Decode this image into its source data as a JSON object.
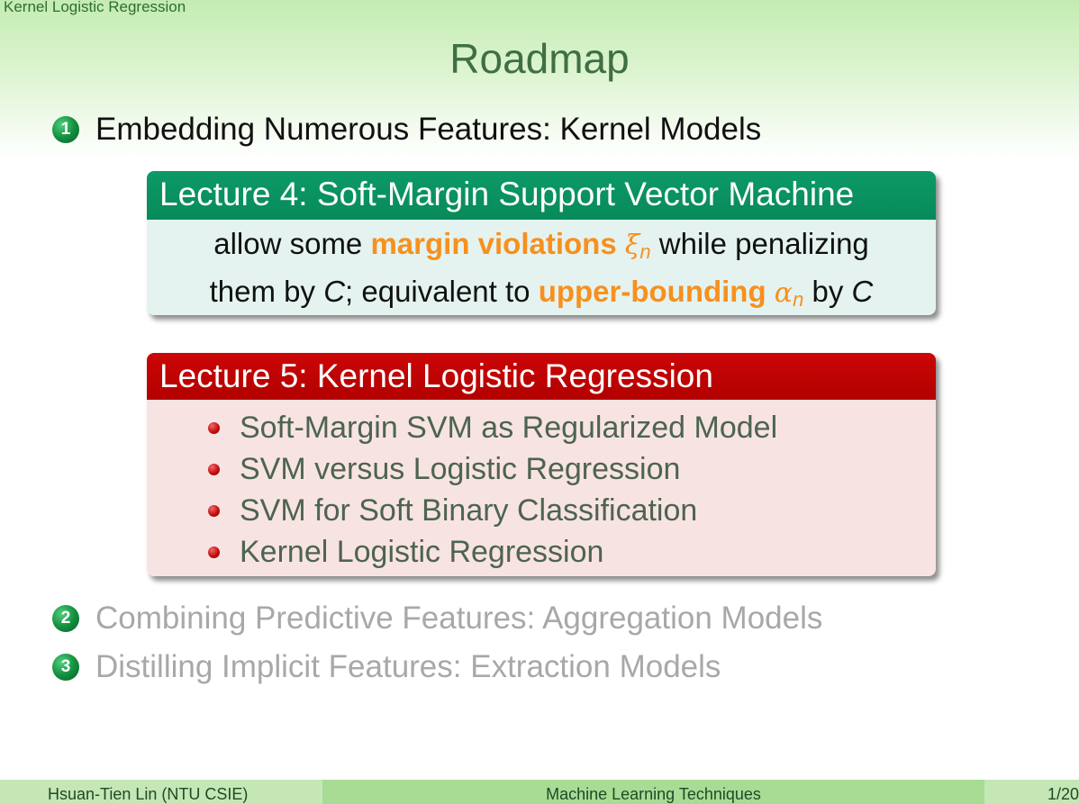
{
  "header": {
    "section": "Kernel Logistic Regression",
    "title": "Roadmap"
  },
  "outline": [
    {
      "number": "1",
      "text": "Embedding Numerous Features: Kernel Models",
      "state": "active"
    },
    {
      "number": "2",
      "text": "Combining Predictive Features: Aggregation Models",
      "state": "dim"
    },
    {
      "number": "3",
      "text": "Distilling Implicit Features: Extraction Models",
      "state": "dim"
    }
  ],
  "lecture4": {
    "title": "Lecture 4: Soft-Margin Support Vector Machine",
    "line1_pre": "allow some ",
    "line1_hl": "margin violations",
    "line1_math": "ξ",
    "line1_math_sub": "n",
    "line1_post": " while penalizing",
    "line2_pre": "them by ",
    "line2_c1": "C",
    "line2_mid": "; equivalent to ",
    "line2_hl": "upper-bounding",
    "line2_math": "α",
    "line2_math_sub": "n",
    "line2_by": " by ",
    "line2_c2": "C"
  },
  "lecture5": {
    "title": "Lecture 5: Kernel Logistic Regression",
    "items": [
      "Soft-Margin SVM as Regularized Model",
      "SVM versus Logistic Regression",
      "SVM for Soft Binary Classification",
      "Kernel Logistic Regression"
    ]
  },
  "footer": {
    "author": "Hsuan-Tien Lin  (NTU CSIE)",
    "course": "Machine Learning Techniques",
    "page": "1/20"
  },
  "colors": {
    "header_gradient": "#c4ecb2",
    "title": "#3f6f45",
    "number_ball": "#14913f",
    "lecture4_header": "#088a5a",
    "lecture4_body": "#e4f3ef",
    "lecture5_header": "#b20000",
    "lecture5_body": "#f8e3e3",
    "highlight": "#f7901e",
    "dim_text": "#a8a8a8",
    "footer": "#a8dc95"
  }
}
